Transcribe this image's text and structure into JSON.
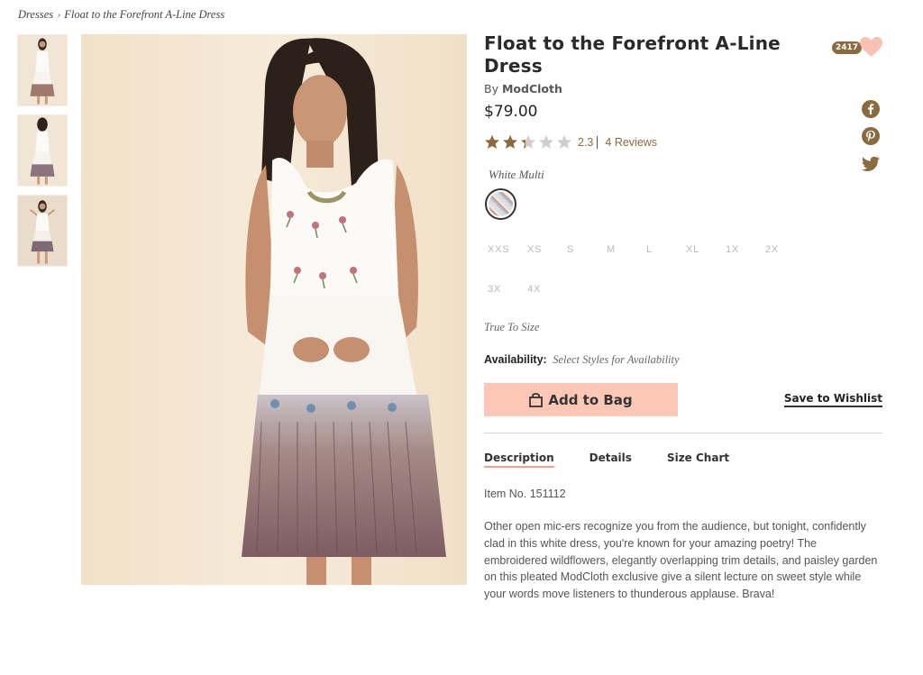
{
  "breadcrumb": {
    "parent": "Dresses",
    "separator": "›",
    "current": "Float to the Forefront A-Line Dress"
  },
  "product": {
    "title": "Float to the Forefront A-Line Dress",
    "by_prefix": "By",
    "brand": "ModCloth",
    "price": "$79.00",
    "rating": "2.3",
    "rating_value": 2.3,
    "rating_max": 5,
    "reviews_label": "4 Reviews",
    "color_name": "White Multi",
    "sizes": [
      "XXS",
      "XS",
      "S",
      "M",
      "L",
      "XL",
      "1X",
      "2X",
      "3X",
      "4X"
    ],
    "fit": "True To Size",
    "availability_label": "Availability:",
    "availability_value": "Select Styles for Availability",
    "add_to_bag": "Add to Bag",
    "save_wishlist": "Save to Wishlist",
    "favorites_count": "2417"
  },
  "tabs": [
    {
      "label": "Description",
      "active": true
    },
    {
      "label": "Details",
      "active": false
    },
    {
      "label": "Size Chart",
      "active": false
    }
  ],
  "description": {
    "item_no": "Item No. 151112",
    "text": "Other open mic-ers recognize you from the audience, but tonight, confidently clad in this white dress, you're known for your amazing poetry! The embroidered wildflowers, elegantly overlapping trim details, and paisley garden on this pleated ModCloth exclusive give a silent lecture on sweet style while your words move listeners to thunderous applause. Brava!"
  },
  "icons": {
    "heart": "heart-icon",
    "facebook": "facebook-icon",
    "pinterest": "pinterest-icon",
    "twitter": "twitter-icon",
    "bag": "shopping-bag-icon"
  },
  "colors": {
    "accent_brown": "#8a6b3f",
    "button_peach": "#fcc7b4",
    "heart_pink": "#f9c1b1",
    "star_filled": "#8a6b3f",
    "star_empty": "#cfcfcf"
  }
}
